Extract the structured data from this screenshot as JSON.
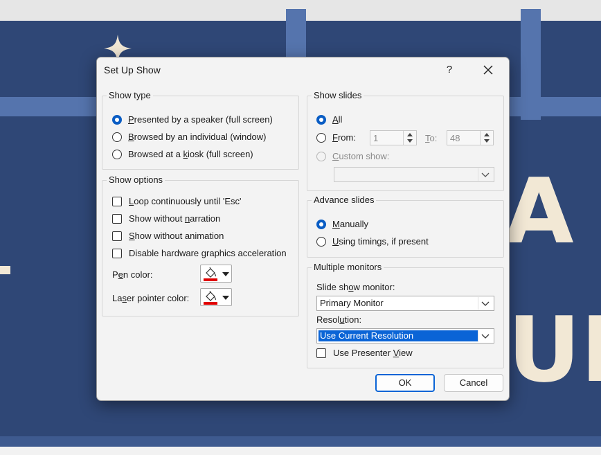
{
  "background": {
    "letter_a": "A",
    "letter_u": "UI"
  },
  "dialog": {
    "title": "Set Up Show",
    "help_label": "?"
  },
  "show_type": {
    "title": "Show type",
    "options": [
      {
        "u": "P",
        "rest": "resented by a speaker (full screen)",
        "checked": true
      },
      {
        "u": "B",
        "rest": "rowsed by an individual (window)",
        "checked": false
      },
      {
        "pre": "Browsed at a ",
        "u": "k",
        "rest": "iosk (full screen)",
        "checked": false
      }
    ]
  },
  "show_options": {
    "title": "Show options",
    "loop": {
      "u": "L",
      "rest": "oop continuously until 'Esc'"
    },
    "no_narration": {
      "pre": "Show without ",
      "u": "n",
      "rest": "arration"
    },
    "no_animation": {
      "u": "S",
      "rest": "how without animation"
    },
    "no_hw_accel": {
      "pre": "Disable hardware ",
      "u": "g",
      "rest": "raphics acceleration"
    },
    "pen_color": {
      "pre": "P",
      "u": "e",
      "rest": "n color:"
    },
    "laser_color": {
      "pre": "La",
      "u": "s",
      "rest": "er pointer color:"
    }
  },
  "show_slides": {
    "title": "Show slides",
    "all": {
      "u": "A",
      "rest": "ll"
    },
    "from": {
      "u": "F",
      "rest": "rom:"
    },
    "from_value": "1",
    "to": {
      "u": "T",
      "rest": "o:"
    },
    "to_value": "48",
    "custom": {
      "u": "C",
      "rest": "ustom show:"
    }
  },
  "advance": {
    "title": "Advance slides",
    "manually": {
      "u": "M",
      "rest": "anually"
    },
    "timings": {
      "u": "U",
      "rest": "sing timings, if present"
    }
  },
  "monitors": {
    "title": "Multiple monitors",
    "monitor_label": {
      "pre": "Slide sh",
      "u": "o",
      "rest": "w monitor:"
    },
    "monitor_value": "Primary Monitor",
    "resolution_label": {
      "pre": "Resol",
      "u": "u",
      "rest": "tion:"
    },
    "resolution_value": "Use Current Resolution",
    "presenter_view": {
      "pre": "Use Presenter ",
      "u": "V",
      "rest": "iew"
    }
  },
  "buttons": {
    "ok": "OK",
    "cancel": "Cancel"
  },
  "colors": {
    "accent": "#0a5dc4",
    "slide_bg": "#2f4776",
    "pen": "#e00000"
  },
  "icons": [
    "close-icon",
    "paint-bucket-icon",
    "chevron-down-icon",
    "sparkle-icon"
  ]
}
